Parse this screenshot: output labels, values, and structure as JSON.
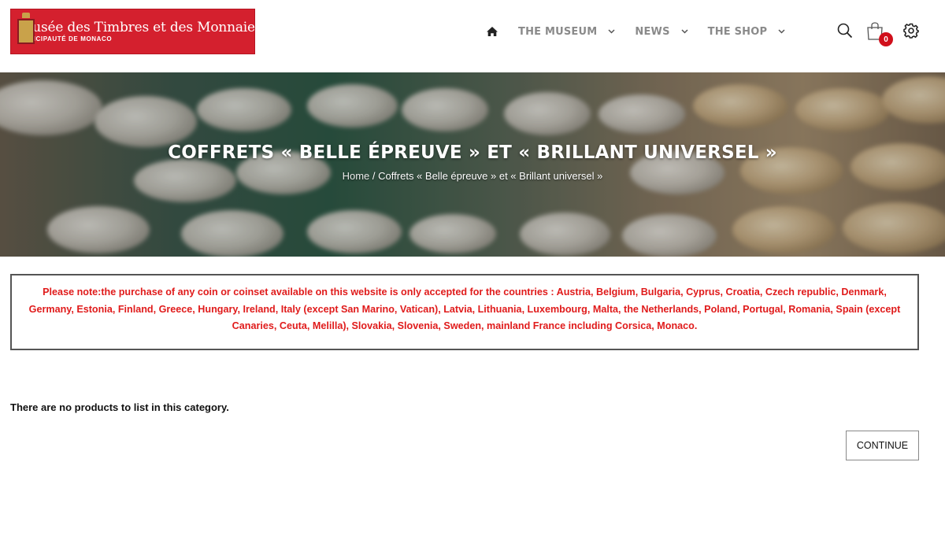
{
  "header": {
    "logo": {
      "title": "Musée des Timbres et des Monnaies",
      "subtitle": "PRINCIPAUTÉ DE MONACO",
      "brand_color": "#d4202e"
    },
    "nav": {
      "home_icon": "home-icon",
      "items": [
        {
          "label": "THE MUSEUM"
        },
        {
          "label": "NEWS"
        },
        {
          "label": "THE SHOP"
        }
      ]
    },
    "tools": {
      "search_icon": "search-icon",
      "cart_icon": "shopping-bag-icon",
      "cart_count": "0",
      "settings_icon": "gear-icon"
    }
  },
  "hero": {
    "title": "COFFRETS « BELLE ÉPREUVE » ET « BRILLANT UNIVERSEL »",
    "breadcrumb": {
      "home": "Home",
      "separator": "/",
      "current": "Coffrets « Belle épreuve » et « Brillant universel »"
    }
  },
  "notice": {
    "text": "Please note:the purchase of any coin or coinset available on this website is only accepted for the countries : Austria, Belgium, Bulgaria, Cyprus, Croatia, Czech republic, Denmark, Germany, Estonia, Finland, Greece, Hungary, Ireland, Italy (except San Marino, Vatican), Latvia, Lithuania, Luxembourg, Malta, the Netherlands, Poland, Portugal, Romania, Spain (except Canaries, Ceuta, Melilla), Slovakia, Slovenia, Sweden, mainland France including Corsica, Monaco.",
    "color": "#e01b1b"
  },
  "content": {
    "empty_message": "There are no products to list in this category.",
    "continue_label": "CONTINUE"
  }
}
